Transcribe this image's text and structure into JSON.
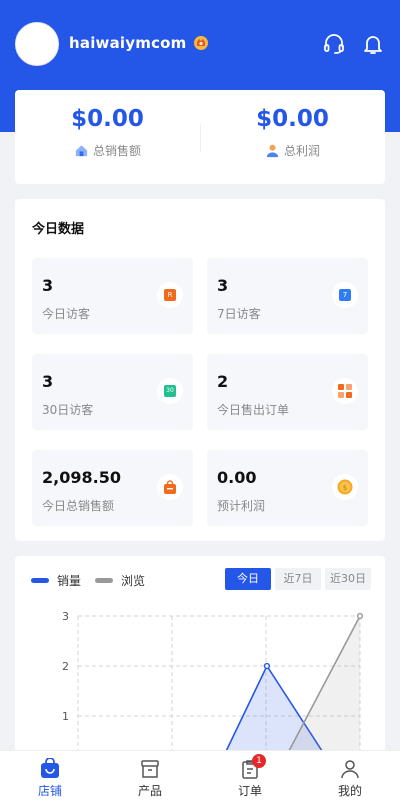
{
  "header": {
    "store_name": "haiwaiymcom",
    "colors": {
      "primary": "#2457e8"
    },
    "icons": [
      "headset-icon",
      "bell-icon"
    ]
  },
  "summary": {
    "total_sales_amount": "$0.00",
    "total_sales_label": "总销售额",
    "total_profit_amount": "$0.00",
    "total_profit_label": "总利润"
  },
  "today": {
    "title": "今日数据",
    "stats": [
      {
        "value": "3",
        "label": "今日访客",
        "icon": "visitor-today-icon",
        "color": "#f26b1d",
        "glyph": "R"
      },
      {
        "value": "3",
        "label": "7日访客",
        "icon": "visitor-7d-icon",
        "color": "#2f7df6",
        "glyph": "7"
      },
      {
        "value": "3",
        "label": "30日访客",
        "icon": "visitor-30d-icon",
        "color": "#21c18f",
        "glyph": "30"
      },
      {
        "value": "2",
        "label": "今日售出订单",
        "icon": "orders-sold-icon",
        "color": "#f26b1d",
        "glyph": ""
      },
      {
        "value": "2,098.50",
        "label": "今日总销售额",
        "icon": "shopping-bag-icon",
        "color": "#f26b1d",
        "glyph": ""
      },
      {
        "value": "0.00",
        "label": "预计利润",
        "icon": "coin-icon",
        "color": "#f5a623",
        "glyph": "$"
      }
    ]
  },
  "chart": {
    "legend": [
      {
        "name": "销量",
        "color": "#2457e8"
      },
      {
        "name": "浏览",
        "color": "#999999"
      }
    ],
    "range_tabs": [
      "今日",
      "近7日",
      "近30日"
    ],
    "active_tab": 0
  },
  "chart_data": {
    "type": "line",
    "y_ticks": [
      1,
      2,
      3
    ],
    "ylim": [
      0,
      3
    ],
    "grid": true,
    "legend_position": "top-left",
    "series": [
      {
        "name": "销量",
        "color": "#2457e8",
        "points": [
          [
            0.0,
            0.0
          ],
          [
            0.33,
            0.0
          ],
          [
            0.5,
            0.0
          ],
          [
            0.67,
            2.0
          ],
          [
            0.9,
            0.0
          ]
        ]
      },
      {
        "name": "浏览",
        "color": "#999999",
        "points": [
          [
            0.0,
            0.0
          ],
          [
            0.67,
            0.0
          ],
          [
            0.72,
            0.0
          ],
          [
            1.0,
            3.0
          ]
        ]
      }
    ]
  },
  "tabbar": {
    "items": [
      {
        "label": "店铺",
        "icon": "store-icon"
      },
      {
        "label": "产品",
        "icon": "product-box-icon"
      },
      {
        "label": "订单",
        "icon": "order-clipboard-icon"
      },
      {
        "label": "我的",
        "icon": "user-icon"
      }
    ],
    "order_badge": "1"
  }
}
